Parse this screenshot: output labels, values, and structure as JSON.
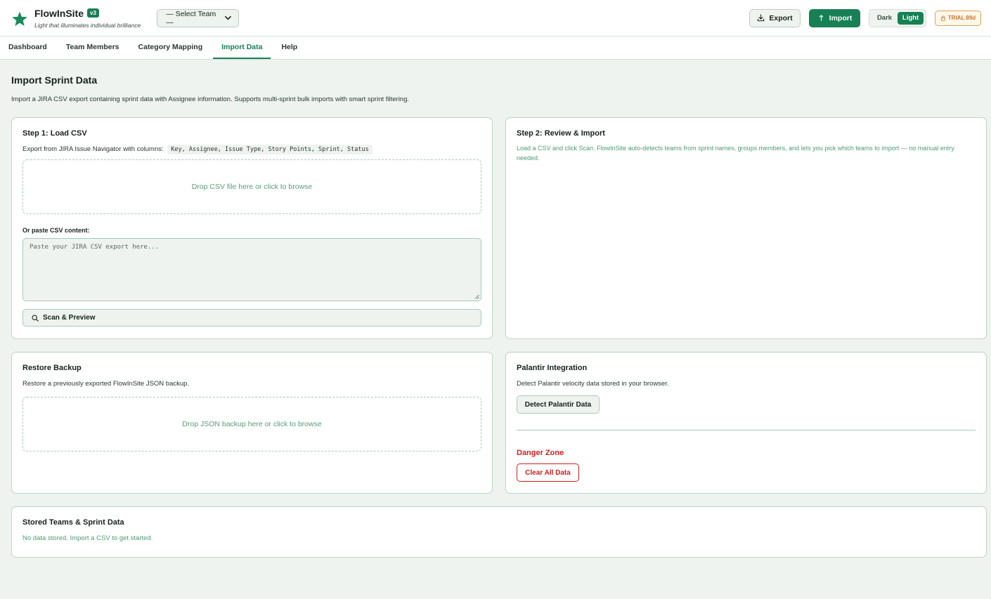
{
  "header": {
    "brand": "FlowInSite",
    "version": "v3",
    "tagline": "Light that illuminates individual brilliance",
    "team_select": "— Select Team —",
    "export_label": "Export",
    "import_label": "Import",
    "theme": {
      "dark": "Dark",
      "light": "Light",
      "active": "Light"
    },
    "trial": "TRIAL 89d"
  },
  "nav": {
    "tabs": [
      {
        "label": "Dashboard"
      },
      {
        "label": "Team Members"
      },
      {
        "label": "Category Mapping"
      },
      {
        "label": "Import Data",
        "active": true
      },
      {
        "label": "Help"
      }
    ]
  },
  "page": {
    "title": "Import Sprint Data",
    "description": "Import a JIRA CSV export containing sprint data with Assignee information. Supports multi-sprint bulk imports with smart sprint filtering."
  },
  "step1": {
    "title": "Step 1: Load CSV",
    "instruction": "Export from JIRA Issue Navigator with columns:",
    "columns": "Key, Assignee, Issue Type, Story Points, Sprint, Status",
    "dropzone": "Drop CSV file here or click to browse",
    "paste_label": "Or paste CSV content:",
    "paste_placeholder": "Paste your JIRA CSV export here...",
    "scan_button": "Scan & Preview"
  },
  "step2": {
    "title": "Step 2: Review & Import",
    "hint": "Load a CSV and click Scan. FlowInSite auto-detects teams from sprint names, groups members, and lets you pick which teams to import — no manual entry needed."
  },
  "restore": {
    "title": "Restore Backup",
    "description": "Restore a previously exported FlowInSite JSON backup.",
    "dropzone": "Drop JSON backup here or click to browse"
  },
  "palantir": {
    "title": "Palantir Integration",
    "description": "Detect Palantir velocity data stored in your browser.",
    "detect_button": "Detect Palantir Data",
    "danger_title": "Danger Zone",
    "clear_button": "Clear All Data"
  },
  "stored": {
    "title": "Stored Teams & Sprint Data",
    "empty": "No data stored. Import a CSV to get started."
  },
  "colors": {
    "accent": "#178055",
    "danger": "#cc1f1f",
    "trial": "#c9762a",
    "background": "#eef3ef"
  },
  "icons": {
    "logo": "star-icon",
    "export": "download-icon",
    "import": "upload-arrow-icon",
    "trial": "lock-icon",
    "scan": "search-icon",
    "select": "chevron-down-icon"
  }
}
